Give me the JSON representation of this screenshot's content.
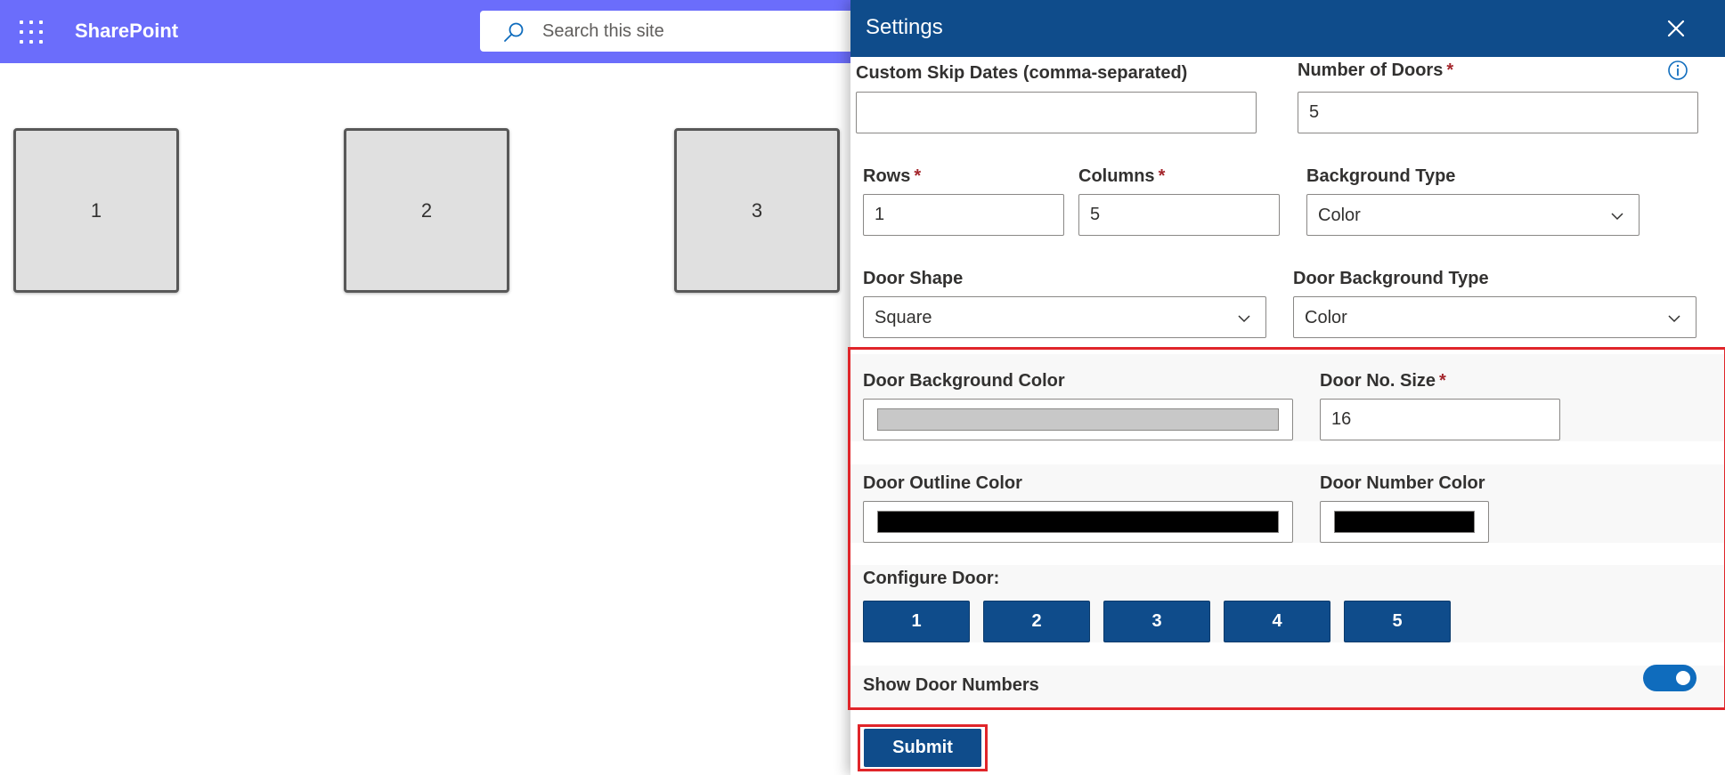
{
  "suitebar": {
    "brand": "SharePoint",
    "search_placeholder": "Search this site"
  },
  "doors_preview": [
    "1",
    "2",
    "3"
  ],
  "panel": {
    "title": "Settings",
    "custom_skip_dates": {
      "label": "Custom Skip Dates (comma-separated)",
      "value": ""
    },
    "number_of_doors": {
      "label": "Number of Doors",
      "required_mark": "*",
      "value": "5"
    },
    "rows": {
      "label": "Rows",
      "required_mark": "*",
      "value": "1"
    },
    "columns": {
      "label": "Columns",
      "required_mark": "*",
      "value": "5"
    },
    "background_type": {
      "label": "Background Type",
      "selected": "Color"
    },
    "door_shape": {
      "label": "Door Shape",
      "selected": "Square"
    },
    "door_background_type": {
      "label": "Door Background Type",
      "selected": "Color"
    },
    "door_background_color": {
      "label": "Door Background Color",
      "color": "#c8c8c8"
    },
    "door_no_size": {
      "label": "Door No. Size",
      "required_mark": "*",
      "value": "16"
    },
    "door_outline_color": {
      "label": "Door Outline Color",
      "color": "#000000"
    },
    "door_number_color": {
      "label": "Door Number Color",
      "color": "#000000"
    },
    "configure_door": {
      "label": "Configure Door:",
      "buttons": [
        "1",
        "2",
        "3",
        "4",
        "5"
      ]
    },
    "show_door_numbers": {
      "label": "Show Door Numbers",
      "on": true
    },
    "submit_label": "Submit"
  },
  "colors": {
    "suitebar": "#6b6dfb",
    "header": "#0f4c8b",
    "primary_button": "#0f4c8b",
    "toggle_on": "#0f6cbd",
    "highlight": "#e0252a"
  }
}
